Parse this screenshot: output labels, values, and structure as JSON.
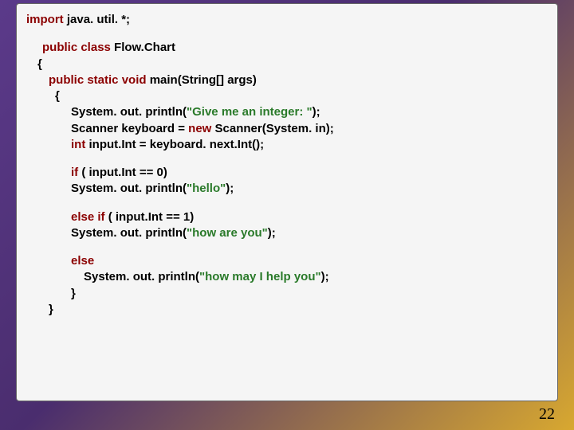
{
  "pageNumber": "22",
  "code": {
    "kw_import": "import",
    "import_rest": " java. util. *;",
    "kw_public1": "public",
    "kw_class": "class",
    "classname": " Flow.Chart",
    "brace_open1": "{",
    "kw_public2": "public",
    "kw_static": "static",
    "kw_void": "void",
    "main_sig": " main(String[] args)",
    "brace_open2": "{",
    "sys_print": "System. out. println(",
    "str_give": "\"Give me an integer: \"",
    "paren_semi": ");",
    "scanner_decl": "Scanner keyboard = ",
    "kw_new": "new",
    "scanner_rest": " Scanner(System. in);",
    "kw_int": "int",
    "int_rest": " input.Int = keyboard. next.Int();",
    "kw_if": "if",
    "if_cond": " ( input.Int  ==  0)",
    "sys_print2": "   System. out. println(",
    "str_hello": "\"hello\"",
    "kw_else1": "else",
    "kw_if2": "if",
    "elseif_cond": " ( input.Int == 1)",
    "sys_print3": "   System. out. println(",
    "str_how": "\"how are you\"",
    "kw_else2": "else",
    "sys_print4": "System. out. println(",
    "str_help": "\"how may I help you\"",
    "brace_close1": "}",
    "brace_close2": "}"
  }
}
